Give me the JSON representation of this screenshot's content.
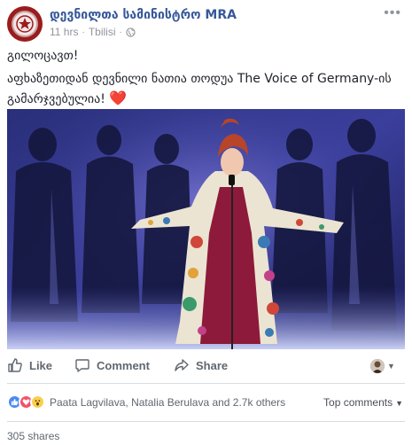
{
  "post": {
    "page_name": "დევნილთა სამინისტრო MRA",
    "time": "11 hrs",
    "location": "Tbilisi",
    "privacy_icon": "globe-icon",
    "menu_icon": "more-options-icon",
    "greeting": "გილოცავთ!",
    "body_line1": "აფხაზეთიდან დევნილი ნათია თოდუა The Voice of Germany-ის",
    "body_line2": "გამარჯვებულია!",
    "heart": "❤️"
  },
  "actions": {
    "like_label": "Like",
    "comment_label": "Comment",
    "share_label": "Share"
  },
  "reactions": {
    "icons": [
      "like",
      "love",
      "wow"
    ],
    "summary": "Paata Lagvilava, Natalia Berulava and 2.7k others",
    "sort_label": "Top comments"
  },
  "shares_label": "305 shares",
  "colors": {
    "link": "#365899",
    "meta": "#90949c",
    "like": "#4a89f3",
    "love": "#f25268",
    "wow": "#f8d04f"
  }
}
